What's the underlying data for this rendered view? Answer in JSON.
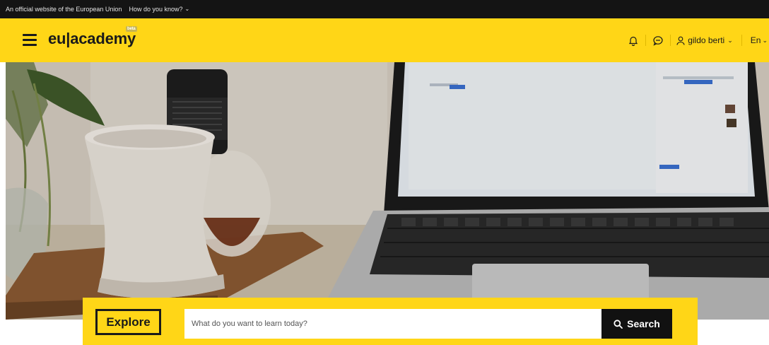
{
  "official_bar": {
    "text": "An official website of the European Union",
    "how_link": "How do you know?"
  },
  "header": {
    "logo_text": "eu|academy",
    "beta_badge": "beta",
    "user_name": "gildo berti",
    "language": "En"
  },
  "hero": {
    "image_icon": "desk-laptop-mug-photo"
  },
  "search": {
    "explore_label": "Explore",
    "placeholder": "What do you want to learn today?",
    "button_label": "Search"
  },
  "colors": {
    "brand_yellow": "#ffd617",
    "dark": "#141414",
    "button_black": "#111111"
  }
}
